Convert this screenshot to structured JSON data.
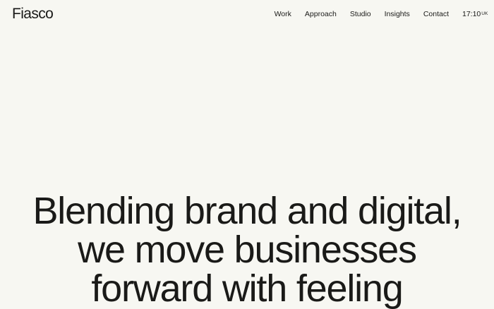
{
  "header": {
    "logo": "Fiasco",
    "nav": [
      {
        "label": "Work"
      },
      {
        "label": "Approach"
      },
      {
        "label": "Studio"
      },
      {
        "label": "Insights"
      },
      {
        "label": "Contact"
      }
    ],
    "clock": {
      "time": "17:10",
      "zone": "UK"
    }
  },
  "hero": {
    "lines": [
      "Blending brand and digital,",
      "we move businesses",
      "forward with feeling"
    ]
  },
  "colors": {
    "background": "#f7f7f2",
    "text": "#1a1a18"
  }
}
